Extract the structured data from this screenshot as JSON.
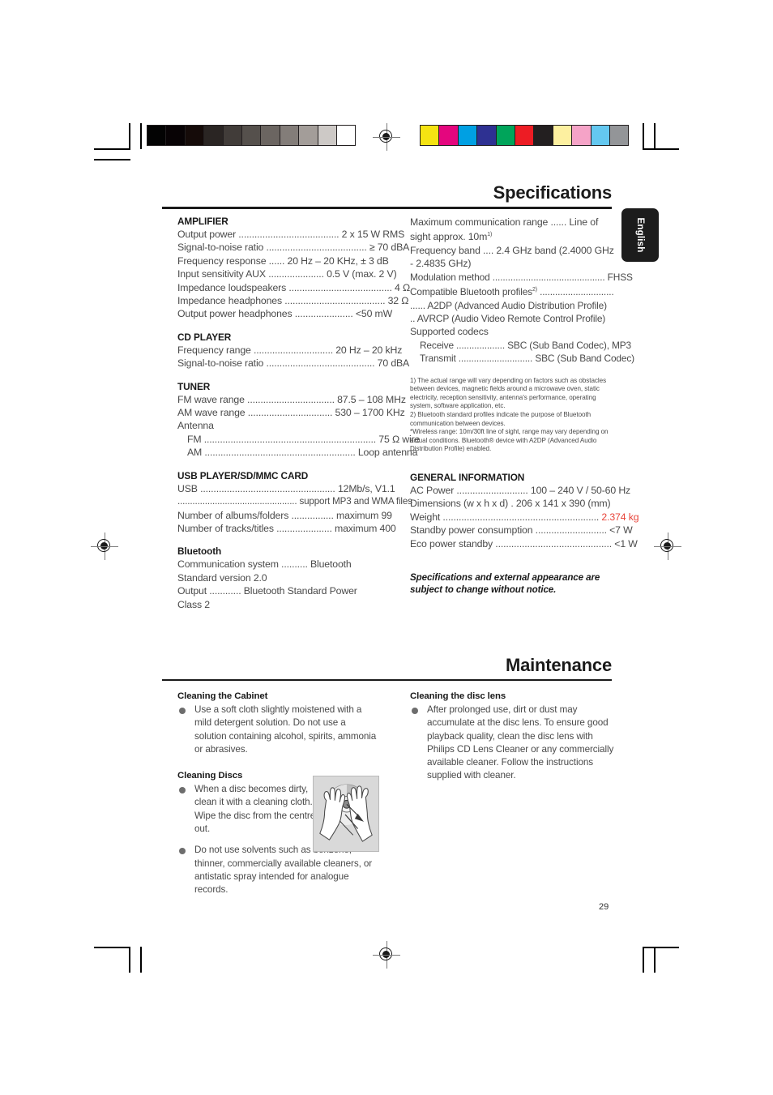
{
  "document": {
    "page_number": "29",
    "language_tab": "English"
  },
  "print_marks": {
    "grayscale_swatches": [
      "#030303",
      "#080305",
      "#150b09",
      "#2a2523",
      "#413c39",
      "#55504c",
      "#6b6561",
      "#837d79",
      "#a39d99",
      "#cdc9c6",
      "#ffffff"
    ],
    "color_swatches": [
      "#f5e312",
      "#e4067e",
      "#00a0e3",
      "#2e3192",
      "#00a45a",
      "#ed1c24",
      "#231f20",
      "#fdf0a0",
      "#f5a3c7",
      "#64c8f0",
      "#939598"
    ]
  },
  "specifications": {
    "title": "Specifications",
    "left_column": [
      {
        "heading": "AMPLIFIER",
        "lines": [
          "Output power ...................................... 2 x 15 W RMS",
          "Signal-to-noise ratio ......................................  ≥ 70 dBA",
          "Frequency response ...... 20 Hz – 20 KHz, ± 3 dB",
          "Input sensitivity AUX ..................... 0.5 V (max. 2 V)",
          "Impedance loudspeakers ....................................... 4 Ω",
          "Impedance headphones ...................................... 32 Ω",
          "Output power headphones ...................... <50 mW"
        ]
      },
      {
        "heading": "CD PLAYER",
        "lines": [
          "Frequency range .............................. 20 Hz – 20 kHz",
          "Signal-to-noise ratio ......................................... 70 dBA"
        ]
      },
      {
        "heading": "TUNER",
        "lines": [
          "FM wave range ................................. 87.5 – 108 MHz",
          "AM wave range ................................ 530 – 1700 KHz",
          "Antenna",
          "FM ................................................................. 75 Ω wire",
          "AM ......................................................... Loop antenna"
        ],
        "indented_from": 3
      },
      {
        "heading": "USB PLAYER/SD/MMC CARD",
        "lines": [
          "USB ................................................... 12Mb/s, V1.1",
          "................................................ support MP3 and WMA files",
          "Number of albums/folders ................ maximum 99",
          "Number of tracks/titles ..................... maximum 400"
        ]
      },
      {
        "heading": "Bluetooth",
        "lines": [
          "Communication system .......... Bluetooth Standard version 2.0",
          "Output ............ Bluetooth Standard Power Class 2"
        ],
        "wrap": true
      }
    ],
    "right_column": {
      "bluetooth_continued": [
        "Maximum communication range ...... Line of sight approx. 10m",
        "Frequency band .... 2.4 GHz band (2.4000 GHz - 2.4835 GHz)",
        "Modulation method ............................................ FHSS",
        "Compatible Bluetooth profiles",
        "...... A2DP (Advanced Audio Distribution Profile)",
        ".. AVRCP (Audio Video Remote Control Profile)",
        "Supported codecs",
        "Receive ................... SBC (Sub Band Codec), MP3",
        "Transmit ............................. SBC (Sub Band Codec)"
      ],
      "footnotes": [
        "1) The actual range will vary depending on factors such as obstacles between devices, magnetic fields around a microwave oven, static electricity, reception sensitivity, antenna's performance, operating system, software application, etc.",
        "2) Bluetooth standard profiles indicate the purpose of Bluetooth communication between devices.",
        "*Wireless range: 10m/30ft line of sight, range may vary depending on actual conditions. Bluetooth® device with A2DP (Advanced Audio Distribution Profile) enabled."
      ],
      "general_information": {
        "heading": "GENERAL INFORMATION",
        "lines": [
          "AC Power ........................... 100 – 240 V / 50-60 Hz",
          "Dimensions (w x h x d) . 206 x 141 x 390 (mm)",
          "Standby power consumption ........................... <7 W",
          "Eco power standby ............................................ <1 W"
        ],
        "weight_label": "Weight ........................................................... ",
        "weight_value": "2.374  kg",
        "weight_color": "#e8443a"
      },
      "disclaimer": "Specifications and external appearance are subject to change without notice."
    }
  },
  "maintenance": {
    "title": "Maintenance",
    "left_column": [
      {
        "heading": "Cleaning the Cabinet",
        "bullets": [
          "Use a soft cloth slightly moistened with a mild detergent solution. Do not use a solution containing alcohol, spirits, ammonia or abrasives."
        ]
      },
      {
        "heading": "Cleaning Discs",
        "bullets": [
          "When a disc becomes dirty, clean it with a cleaning cloth. Wipe the disc from the centre out.",
          "Do not use solvents such as benzene, thinner, commercially available cleaners, or antistatic spray intended for analogue records."
        ]
      }
    ],
    "right_column": [
      {
        "heading": "Cleaning the disc lens",
        "bullets": [
          "After prolonged use, dirt or dust may accumulate at the disc lens. To ensure good playback quality, clean the disc lens with Philips CD Lens Cleaner or any commercially available cleaner. Follow the instructions supplied with cleaner."
        ]
      }
    ],
    "illustration_alt": "hands-cleaning-disc-illustration"
  }
}
